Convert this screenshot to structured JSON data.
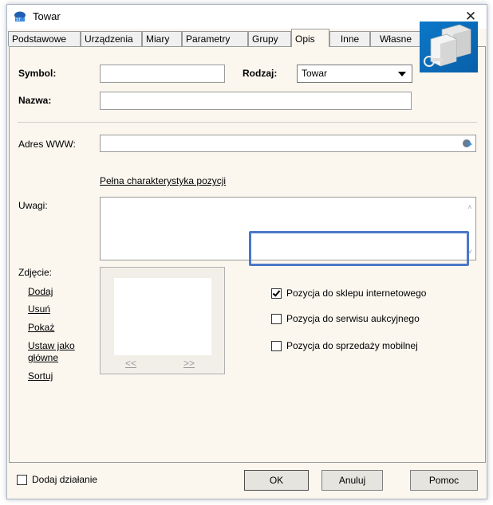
{
  "window": {
    "title": "Towar",
    "close_symbol": "✕"
  },
  "tabs": [
    {
      "label": "Podstawowe"
    },
    {
      "label": "Urządzenia"
    },
    {
      "label": "Miary"
    },
    {
      "label": "Parametry"
    },
    {
      "label": "Grupy"
    },
    {
      "label": "Opis"
    },
    {
      "label": "Inne"
    },
    {
      "label": "Własne"
    }
  ],
  "active_tab": "Opis",
  "form": {
    "symbol_label": "Symbol:",
    "symbol_value": "",
    "rodzaj_label": "Rodzaj:",
    "rodzaj_value": "Towar",
    "nazwa_label": "Nazwa:",
    "nazwa_value": "",
    "www_label": "Adres WWW:",
    "www_value": "",
    "char_link": "Pełna charakterystyka pozycji",
    "uwagi_label": "Uwagi:",
    "uwagi_value": ""
  },
  "photo": {
    "label": "Zdjęcie:",
    "actions": [
      "Dodaj",
      "Usuń",
      "Pokaż",
      "Ustaw jako",
      "główne",
      "Sortuj"
    ],
    "prev": "<<",
    "next": ">>"
  },
  "checkboxes": [
    {
      "label": "Pozycja do sklepu internetowego",
      "checked": true
    },
    {
      "label": "Pozycja do serwisu aukcyjnego",
      "checked": false
    },
    {
      "label": "Pozycja do sprzedaży mobilnej",
      "checked": false
    }
  ],
  "footer": {
    "add_action_label": "Dodaj działanie",
    "add_action_checked": false,
    "ok": "OK",
    "cancel": "Anuluj",
    "help": "Pomoc"
  },
  "colors": {
    "highlight": "#4b78c8",
    "panel_bg": "#fbf7ef"
  },
  "icons": {
    "title": "app-logo-icon",
    "product": "product-boxes-icon",
    "www": "open-link-icon"
  }
}
